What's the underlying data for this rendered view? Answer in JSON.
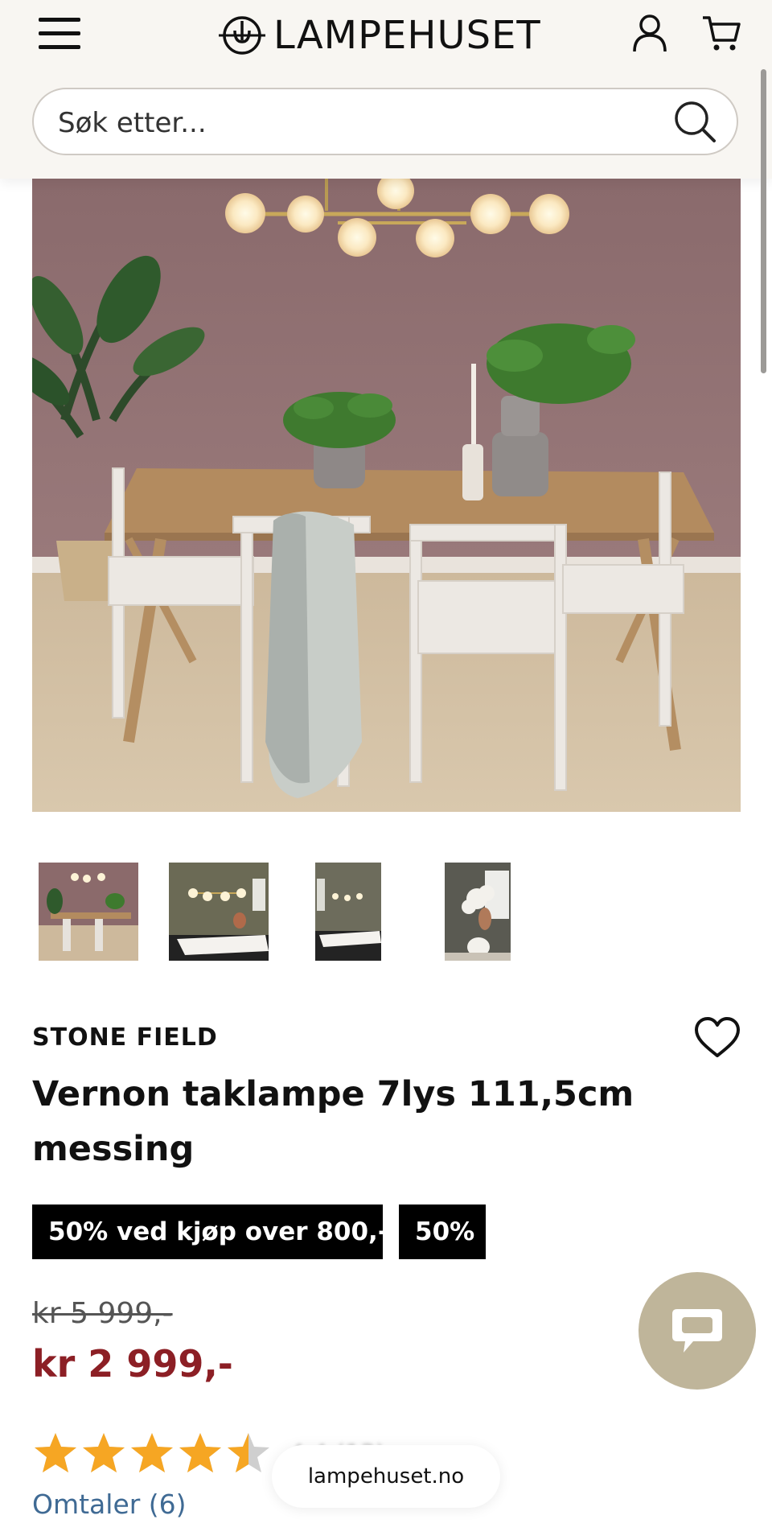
{
  "header": {
    "logo_text": "LAMPEHUSET",
    "search_placeholder": "Søk etter..."
  },
  "product": {
    "brand": "STONE FIELD",
    "title": "Vernon taklampe 7lys 111,5cm messing",
    "tags": [
      "50% ved kjøp over 800,-",
      "50%"
    ],
    "old_price": "kr 5 999,-",
    "price": "kr 2 999,-",
    "rating_stars": 4.5,
    "rating_max": 5,
    "reviews_link": "Omtaler (6)"
  },
  "gallery": {
    "image_count": 4,
    "selected_index": 0
  },
  "browser": {
    "url": "lampehuset.no"
  },
  "colors": {
    "price_red": "#8c1f25",
    "star_gold": "#f6a623",
    "chat_bg": "#bfb59a",
    "link_blue": "#3f6a94",
    "header_bg": "#f8f6f2"
  },
  "icons": [
    "menu-icon",
    "logo-lamp-icon",
    "user-icon",
    "cart-icon",
    "search-icon",
    "heart-icon",
    "chat-icon",
    "star-icon"
  ]
}
